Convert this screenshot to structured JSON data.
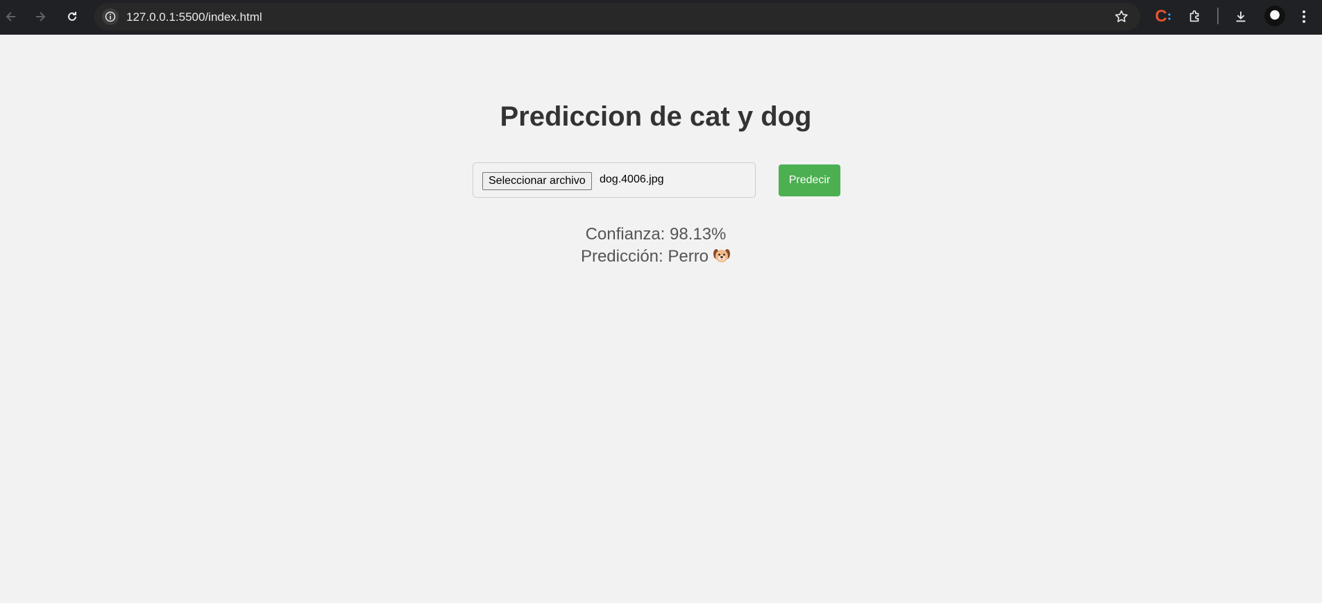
{
  "browser": {
    "url": "127.0.0.1:5500/index.html",
    "icons": [
      "back-arrow-icon",
      "forward-arrow-icon",
      "reload-icon",
      "info-icon",
      "star-icon",
      "extension-c-icon",
      "puzzle-icon",
      "download-icon",
      "profile-avatar",
      "more-menu-icon"
    ],
    "extension_letter": "C"
  },
  "page": {
    "title": "Prediccion de cat y dog",
    "file_input": {
      "button_label": "Seleccionar archivo",
      "file_name": "dog.4006.jpg"
    },
    "predict_label": "Predecir",
    "confidence": "Confianza: 98.13%",
    "prediction": "Predicción: Perro",
    "prediction_icon": "dog-face-emoji",
    "colors": {
      "background": "#f2f2f2",
      "predict_button": "#4caf50",
      "title": "#333333",
      "result_text": "#555555"
    }
  }
}
